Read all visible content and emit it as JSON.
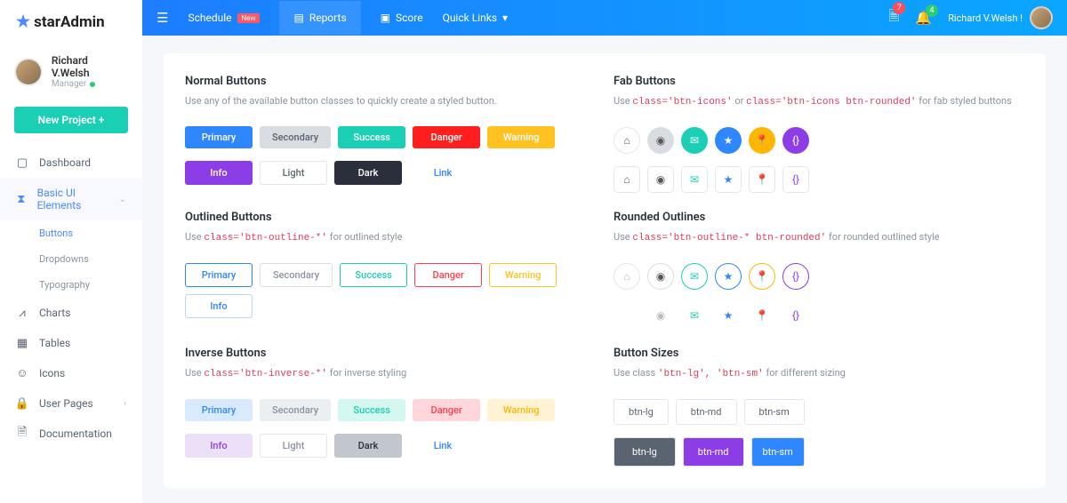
{
  "brand": {
    "name": "starAdmin"
  },
  "user": {
    "name": "Richard V.Welsh",
    "role": "Manager"
  },
  "sidebar": {
    "newProject": "New Project +",
    "items": [
      {
        "icon": "▢",
        "label": "Dashboard"
      },
      {
        "icon": "⧗",
        "label": "Basic UI Elements"
      },
      {
        "icon": "⩘",
        "label": "Charts"
      },
      {
        "icon": "▦",
        "label": "Tables"
      },
      {
        "icon": "☺",
        "label": "Icons"
      },
      {
        "icon": "🔒",
        "label": "User Pages"
      },
      {
        "icon": "🗎",
        "label": "Documentation"
      }
    ],
    "sub": [
      "Buttons",
      "Dropdowns",
      "Typography"
    ]
  },
  "topbar": {
    "links": {
      "schedule": "Schedule",
      "new": "New",
      "reports": "Reports",
      "score": "Score",
      "quick": "Quick Links"
    },
    "notif1": "7",
    "notif2": "4",
    "user": "Richard V.Welsh !"
  },
  "sections": {
    "normal": {
      "title": "Normal Buttons",
      "desc": "Use any of the available button classes to quickly create a styled button.",
      "labels": [
        "Primary",
        "Secondary",
        "Success",
        "Danger",
        "Warning",
        "Info",
        "Light",
        "Dark",
        "Link"
      ]
    },
    "fab": {
      "title": "Fab Buttons",
      "descPre": "Use",
      "code1": "class='btn-icons'",
      "or": "or",
      "code2": "class='btn-icons btn-rounded'",
      "descPost": "for fab styled buttons"
    },
    "outlined": {
      "title": "Outlined Buttons",
      "descPre": "Use",
      "code": "class='btn-outline-*'",
      "descPost": "for outlined style",
      "labels": [
        "Primary",
        "Secondary",
        "Success",
        "Danger",
        "Warning",
        "Info"
      ]
    },
    "rounded": {
      "title": "Rounded Outlines",
      "descPre": "Use",
      "code": "class='btn-outline-* btn-rounded'",
      "descPost": "for rounded outlined style"
    },
    "inverse": {
      "title": "Inverse Buttons",
      "descPre": "Use",
      "code": "class='btn-inverse-*'",
      "descPost": "for inverse styling",
      "labels": [
        "Primary",
        "Secondary",
        "Success",
        "Danger",
        "Warning",
        "Info",
        "Light",
        "Dark",
        "Link"
      ]
    },
    "sizes": {
      "title": "Button Sizes",
      "descPre": "Use class",
      "code": "'btn-lg', 'btn-sm'",
      "descPost": "for different sizing",
      "labels": [
        "btn-lg",
        "btn-md",
        "btn-sm"
      ]
    }
  }
}
